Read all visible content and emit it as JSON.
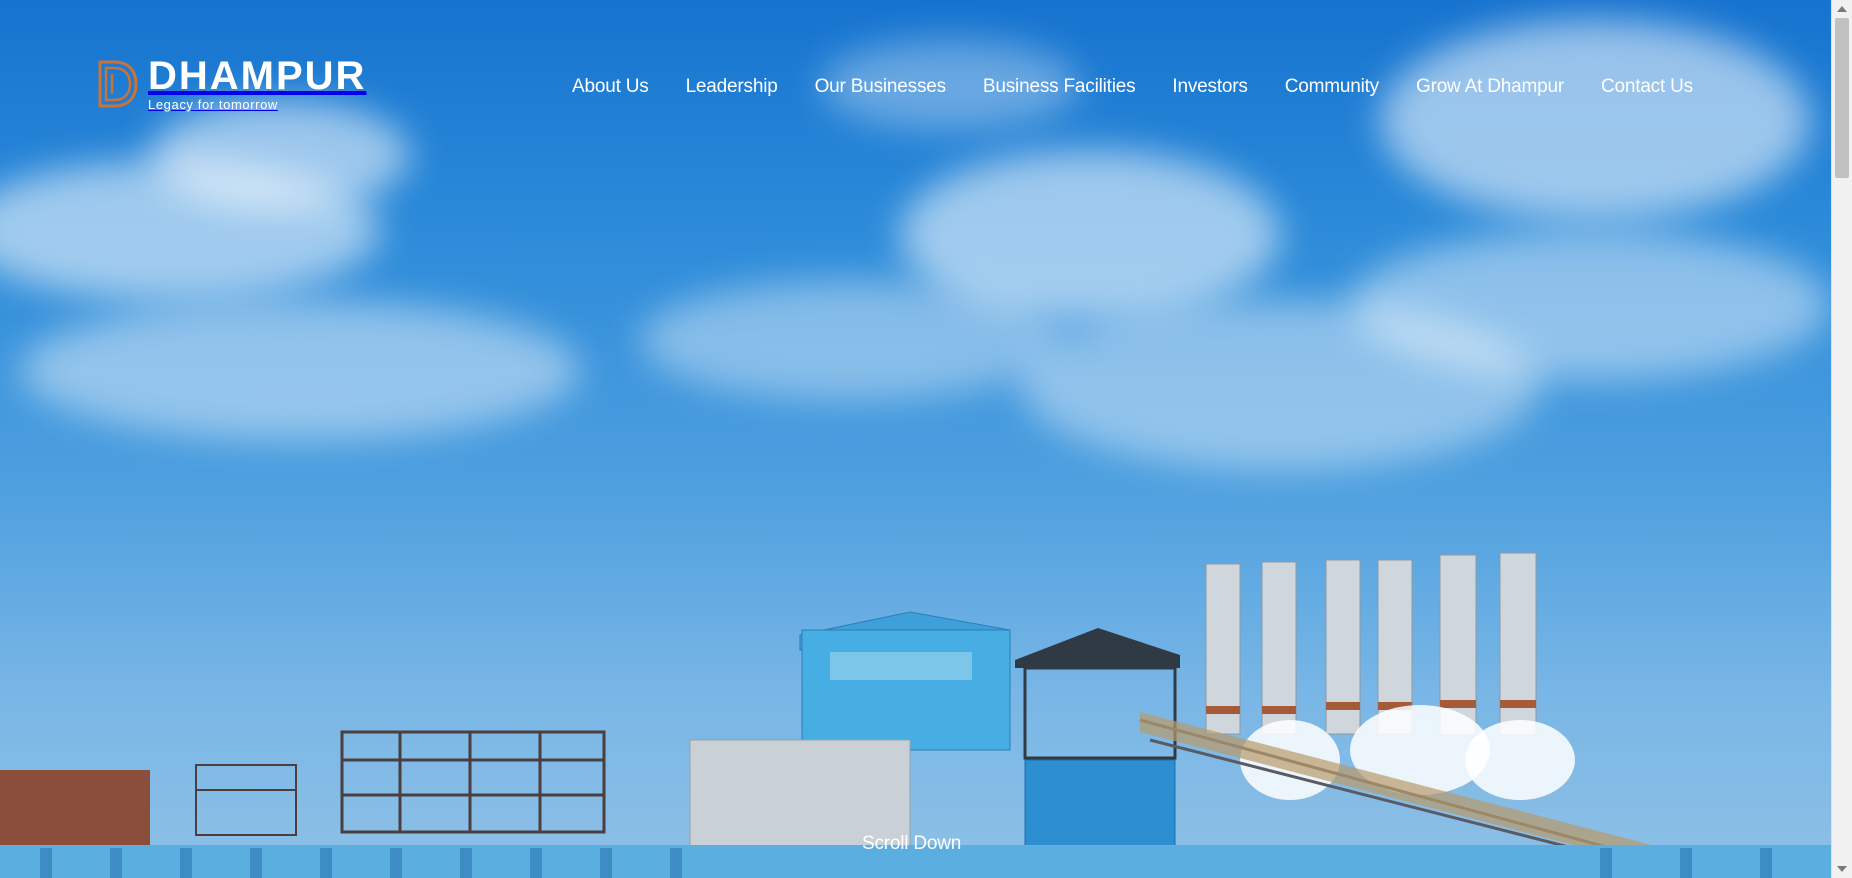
{
  "brand": {
    "name": "DHAMPUR",
    "tagline": "Legacy for tomorrow",
    "accent_color": "#c8733a"
  },
  "nav": {
    "items": [
      {
        "label": "About Us"
      },
      {
        "label": "Leadership"
      },
      {
        "label": "Our Businesses"
      },
      {
        "label": "Business Facilities"
      },
      {
        "label": "Investors"
      },
      {
        "label": "Community"
      },
      {
        "label": "Grow At Dhampur"
      },
      {
        "label": "Contact Us"
      }
    ]
  },
  "hero": {
    "image": "industrial-plant-photo",
    "scroll_label": "Scroll Down"
  },
  "scrollbar": {
    "icon_up": "arrow-up-icon",
    "icon_down": "arrow-down-icon"
  }
}
